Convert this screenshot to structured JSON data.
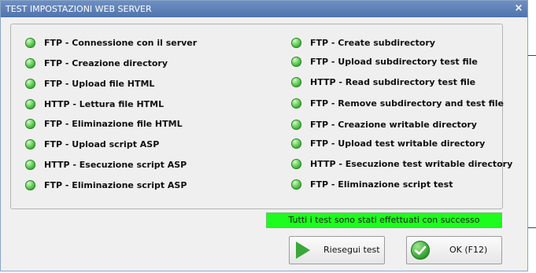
{
  "window": {
    "title": "TEST IMPOSTAZIONI WEB SERVER",
    "close_glyph": "×"
  },
  "checks": {
    "left": [
      "FTP - Connessione con il server",
      "FTP - Creazione directory",
      "FTP - Upload file HTML",
      "HTTP - Lettura file HTML",
      "FTP - Eliminazione file HTML",
      "FTP - Upload script ASP",
      "HTTP - Esecuzione script ASP",
      "FTP - Eliminazione script ASP"
    ],
    "right": [
      "FTP - Create subdirectory",
      "FTP - Upload subdirectory test file",
      "HTTP - Read subdirectory test file",
      "FTP - Remove subdirectory and test file",
      "FTP - Creazione writable directory",
      "FTP - Upload test writable directory",
      "HTTP - Esecuzione test writable directory",
      "FTP - Eliminazione script test"
    ]
  },
  "status": {
    "text": "Tutti i test sono stati effettuati con successo",
    "color": "#1dfd1d"
  },
  "buttons": {
    "rerun_label": "Riesegui test",
    "ok_label": "OK (F12)"
  },
  "icons": {
    "status_led": "green-led-icon",
    "rerun": "play-icon",
    "ok": "check-icon",
    "close": "close-icon"
  }
}
